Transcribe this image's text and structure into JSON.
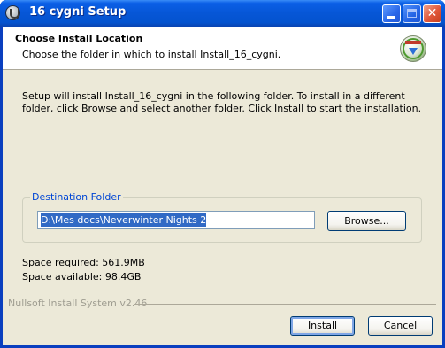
{
  "window": {
    "title": "16 cygni Setup",
    "icon": "installer-icon"
  },
  "titlebar_buttons": {
    "minimize": "minimize-icon",
    "maximize": "maximize-icon",
    "close": "✕"
  },
  "header": {
    "title": "Choose Install Location",
    "subtitle": "Choose the folder in which to install Install_16_cygni.",
    "icon": "install-disc-icon"
  },
  "intro_text": "Setup will install Install_16_cygni in the following folder. To install in a different folder, click Browse and select another folder. Click Install to start the installation.",
  "destination": {
    "group_label": "Destination Folder",
    "path": "D:\\Mes docs\\Neverwinter Nights 2",
    "browse_label": "Browse..."
  },
  "space": {
    "required": "Space required: 561.9MB",
    "available": "Space available: 98.4GB"
  },
  "branding": "Nullsoft Install System v2.46",
  "footer": {
    "install_label": "Install",
    "cancel_label": "Cancel"
  },
  "colors": {
    "titlebar": "#0656d6",
    "dialog_bg": "#ece9d8",
    "group_label": "#0046d5",
    "selection": "#316ac5"
  }
}
